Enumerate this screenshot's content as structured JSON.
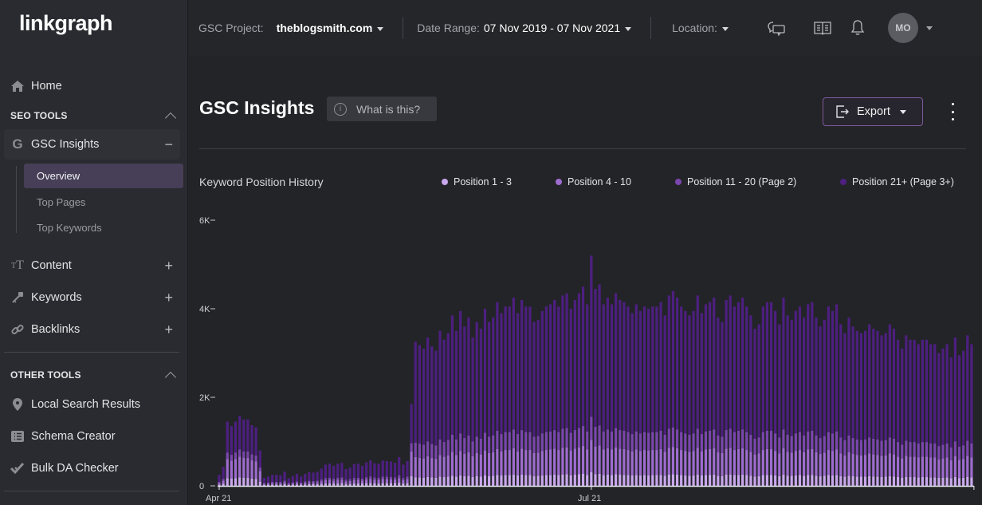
{
  "app": {
    "logo": "linkgraph"
  },
  "sidebar": {
    "home": "Home",
    "seo_tools_heading": "SEO TOOLS",
    "gsc_insights": "GSC Insights",
    "gsc_sub": [
      "Overview",
      "Top Pages",
      "Top Keywords"
    ],
    "content": "Content",
    "keywords": "Keywords",
    "backlinks": "Backlinks",
    "other_tools_heading": "OTHER TOOLS",
    "local_search": "Local Search Results",
    "schema_creator": "Schema Creator",
    "bulk_da": "Bulk DA Checker"
  },
  "topbar": {
    "project_label": "GSC Project:",
    "project_value": "theblogsmith.com",
    "date_label": "Date Range:",
    "date_value": "07 Nov 2019 - 07 Nov 2021",
    "location_label": "Location:",
    "avatar_initials": "MO"
  },
  "main": {
    "title": "GSC Insights",
    "what_is_this": "What is this?",
    "export_label": "Export"
  },
  "chart_data": {
    "type": "bar",
    "stacked": true,
    "title": "Keyword Position History",
    "xlabel": "",
    "ylabel": "",
    "ylim": [
      0,
      6000
    ],
    "yticks": [
      0,
      2000,
      4000,
      6000
    ],
    "ytick_labels": [
      "0",
      "2K",
      "4K",
      "6K"
    ],
    "xtick_labels": [
      {
        "label": "Apr 21",
        "index": 0
      },
      {
        "label": "Jul 21",
        "index": 91
      }
    ],
    "legend_position": "top-right",
    "series": [
      {
        "name": "Position 1 - 3",
        "color": "#c9a7ec"
      },
      {
        "name": "Position 4 - 10",
        "color": "#9e6ccf"
      },
      {
        "name": "Position 11 - 20 (Page 2)",
        "color": "#7a46ae"
      },
      {
        "name": "Position 21+ (Page 3+)",
        "color": "#4d1f80"
      }
    ],
    "totals": [
      250,
      430,
      1450,
      1350,
      1450,
      1580,
      1500,
      1500,
      1370,
      1320,
      800,
      180,
      210,
      250,
      250,
      240,
      320,
      170,
      220,
      270,
      210,
      270,
      310,
      300,
      320,
      390,
      480,
      500,
      450,
      500,
      520,
      380,
      410,
      490,
      500,
      450,
      530,
      580,
      510,
      500,
      570,
      560,
      550,
      520,
      650,
      480,
      560,
      1850,
      3250,
      3180,
      3100,
      3350,
      3150,
      3050,
      3500,
      3300,
      3450,
      3850,
      3500,
      3950,
      3600,
      3800,
      3350,
      3700,
      3550,
      4000,
      3700,
      3800,
      4150,
      3900,
      4050,
      4050,
      4250,
      3900,
      4200,
      4050,
      4050,
      3700,
      3750,
      3950,
      4050,
      4100,
      4200,
      4050,
      4300,
      4350,
      4000,
      4200,
      4350,
      4500,
      4100,
      5200,
      4450,
      4550,
      4100,
      4250,
      4100,
      4350,
      4200,
      4150,
      4050,
      3900,
      4100,
      3950,
      4050,
      4000,
      4050,
      4050,
      4150,
      3850,
      4300,
      4400,
      4250,
      4050,
      3950,
      3850,
      3950,
      4300,
      3900,
      4100,
      4150,
      4250,
      3800,
      3700,
      4200,
      4300,
      4050,
      4150,
      4250,
      4050,
      3850,
      3550,
      3650,
      4050,
      4150,
      4150,
      3950,
      3650,
      4250,
      3850,
      3750,
      3950,
      4050,
      3800,
      4100,
      4150,
      3800,
      3600,
      3750,
      4050,
      3950,
      4100,
      3650,
      3450,
      3800,
      3600,
      3500,
      3450,
      3500,
      3650,
      3550,
      3500,
      3400,
      3450,
      3650,
      3550,
      3300,
      3100,
      3400,
      3300,
      3300,
      3200,
      3300,
      3300,
      3200,
      3200,
      3000,
      3100,
      3200,
      2900,
      3350,
      2950,
      3050,
      3400,
      3200
    ]
  }
}
